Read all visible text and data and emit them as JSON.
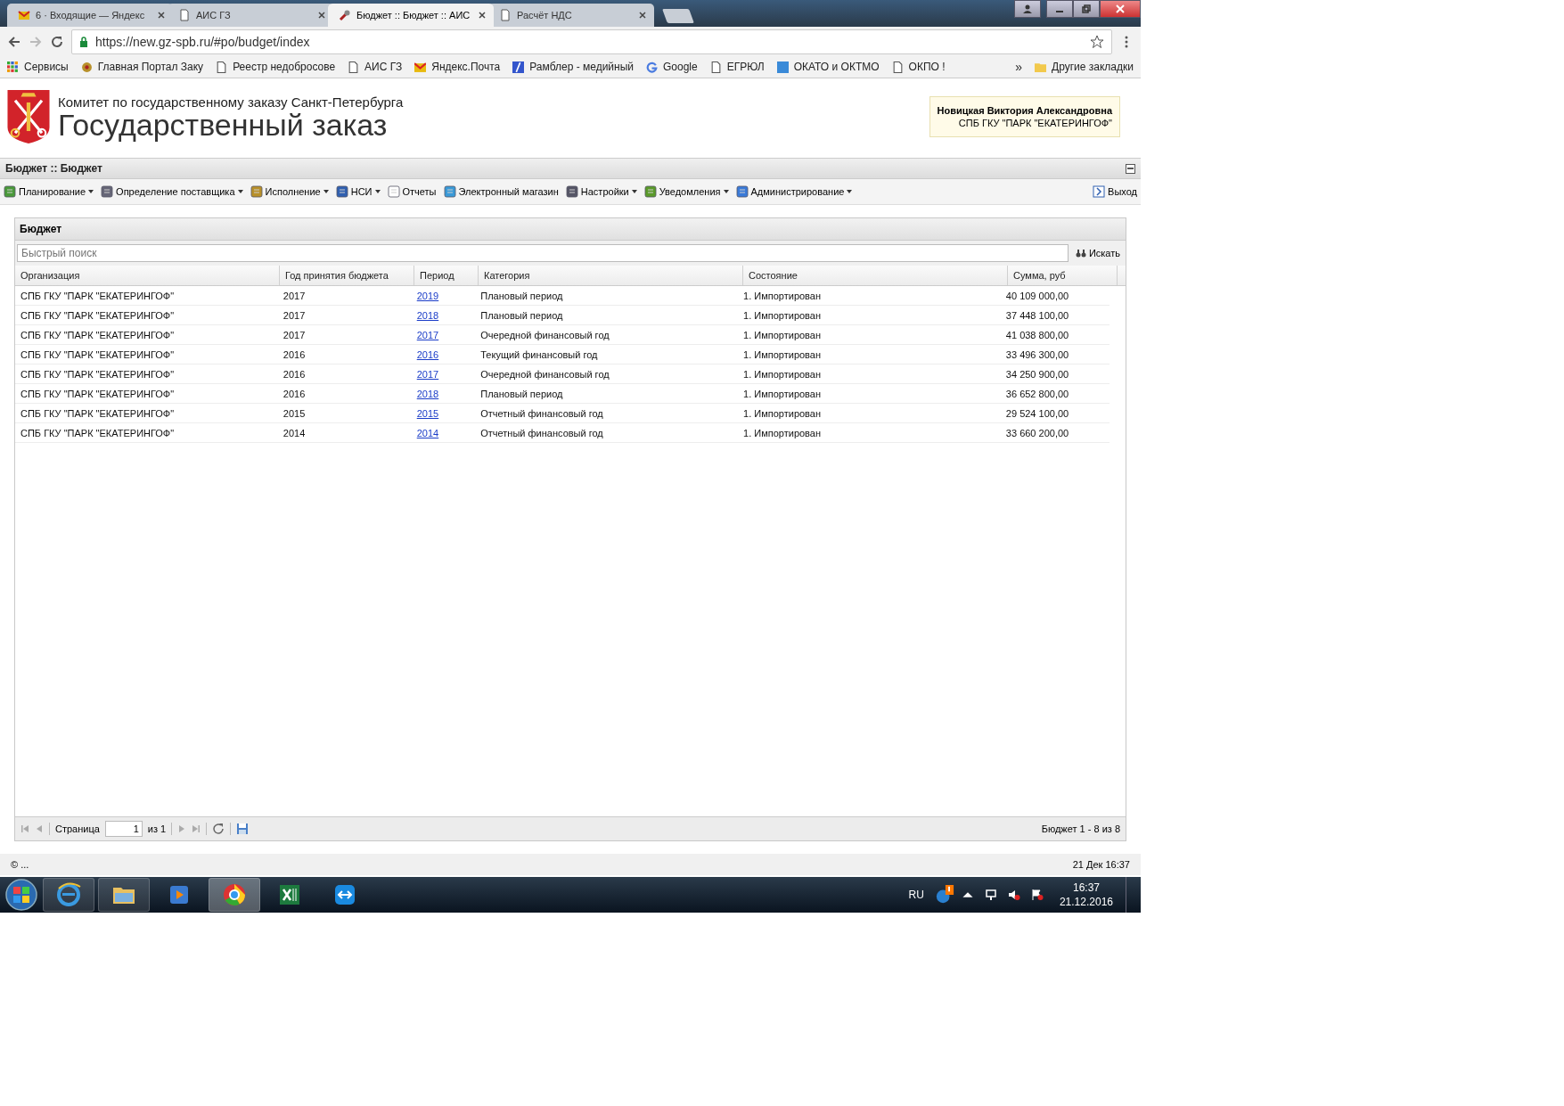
{
  "browser": {
    "tabs": [
      {
        "title": "6 · Входящие — Яндекс",
        "kind": "mail",
        "selected": false
      },
      {
        "title": "АИС ГЗ",
        "kind": "doc",
        "selected": false
      },
      {
        "title": "Бюджет :: Бюджет :: АИС",
        "kind": "tool",
        "selected": true
      },
      {
        "title": "Расчёт НДС",
        "kind": "doc",
        "selected": false
      }
    ],
    "url": "https://new.gz-spb.ru/#po/budget/index",
    "bookmarks": [
      {
        "label": "Сервисы",
        "kind": "apps"
      },
      {
        "label": "Главная Портал Заку",
        "kind": "emblem"
      },
      {
        "label": "Реестр недобросове",
        "kind": "doc"
      },
      {
        "label": "АИС ГЗ",
        "kind": "doc"
      },
      {
        "label": "Яндекс.Почта",
        "kind": "mail"
      },
      {
        "label": "Рамблер - медийный",
        "kind": "slash"
      },
      {
        "label": "Google",
        "kind": "google"
      },
      {
        "label": "ЕГРЮЛ",
        "kind": "doc"
      },
      {
        "label": "ОКАТО и ОКТМО",
        "kind": "square"
      },
      {
        "label": "ОКПО !",
        "kind": "doc"
      }
    ],
    "more": "»",
    "other_bookmarks": "Другие закладки"
  },
  "header": {
    "org_title": "Комитет по государственному заказу Санкт-Петербурга",
    "app_title": "Государственный заказ",
    "user": {
      "name": "Новицкая Виктория Александровна",
      "org": "СПБ ГКУ \"ПАРК \"ЕКАТЕРИНГОФ\""
    }
  },
  "panel_title": "Бюджет :: Бюджет",
  "menu": [
    {
      "label": "Планирование",
      "dropdown": true
    },
    {
      "label": "Определение поставщика",
      "dropdown": true
    },
    {
      "label": "Исполнение",
      "dropdown": true
    },
    {
      "label": "НСИ",
      "dropdown": true
    },
    {
      "label": "Отчеты",
      "dropdown": false
    },
    {
      "label": "Электронный магазин",
      "dropdown": false
    },
    {
      "label": "Настройки",
      "dropdown": true
    },
    {
      "label": "Уведомления",
      "dropdown": true
    },
    {
      "label": "Администрирование",
      "dropdown": true
    }
  ],
  "logout": "Выход",
  "grid": {
    "title": "Бюджет",
    "search": {
      "placeholder": "Быстрый поиск"
    },
    "search_button": "Искать",
    "columns": [
      "Организация",
      "Год принятия бюджета",
      "Период",
      "Категория",
      "Состояние",
      "Сумма, руб"
    ],
    "rows": [
      [
        "СПБ ГКУ \"ПАРК \"ЕКАТЕРИНГОФ\"",
        "2017",
        "2019",
        "Плановый период",
        "1. Импортирован",
        "40 109 000,00"
      ],
      [
        "СПБ ГКУ \"ПАРК \"ЕКАТЕРИНГОФ\"",
        "2017",
        "2018",
        "Плановый период",
        "1. Импортирован",
        "37 448 100,00"
      ],
      [
        "СПБ ГКУ \"ПАРК \"ЕКАТЕРИНГОФ\"",
        "2017",
        "2017",
        "Очередной финансовый год",
        "1. Импортирован",
        "41 038 800,00"
      ],
      [
        "СПБ ГКУ \"ПАРК \"ЕКАТЕРИНГОФ\"",
        "2016",
        "2016",
        "Текущий финансовый год",
        "1. Импортирован",
        "33 496 300,00"
      ],
      [
        "СПБ ГКУ \"ПАРК \"ЕКАТЕРИНГОФ\"",
        "2016",
        "2017",
        "Очередной финансовый год",
        "1. Импортирован",
        "34 250 900,00"
      ],
      [
        "СПБ ГКУ \"ПАРК \"ЕКАТЕРИНГОФ\"",
        "2016",
        "2018",
        "Плановый период",
        "1. Импортирован",
        "36 652 800,00"
      ],
      [
        "СПБ ГКУ \"ПАРК \"ЕКАТЕРИНГОФ\"",
        "2015",
        "2015",
        "Отчетный финансовый год",
        "1. Импортирован",
        "29 524 100,00"
      ],
      [
        "СПБ ГКУ \"ПАРК \"ЕКАТЕРИНГОФ\"",
        "2014",
        "2014",
        "Отчетный финансовый год",
        "1. Импортирован",
        "33 660 200,00"
      ]
    ],
    "pager": {
      "page_label": "Страница",
      "page": "1",
      "of": "из 1",
      "summary": "Бюджет 1 - 8 из 8"
    }
  },
  "status": {
    "left": "© ...",
    "right": "21 Дек 16:37"
  },
  "taskbar": {
    "lang": "RU",
    "time": "16:37",
    "date": "21.12.2016"
  }
}
